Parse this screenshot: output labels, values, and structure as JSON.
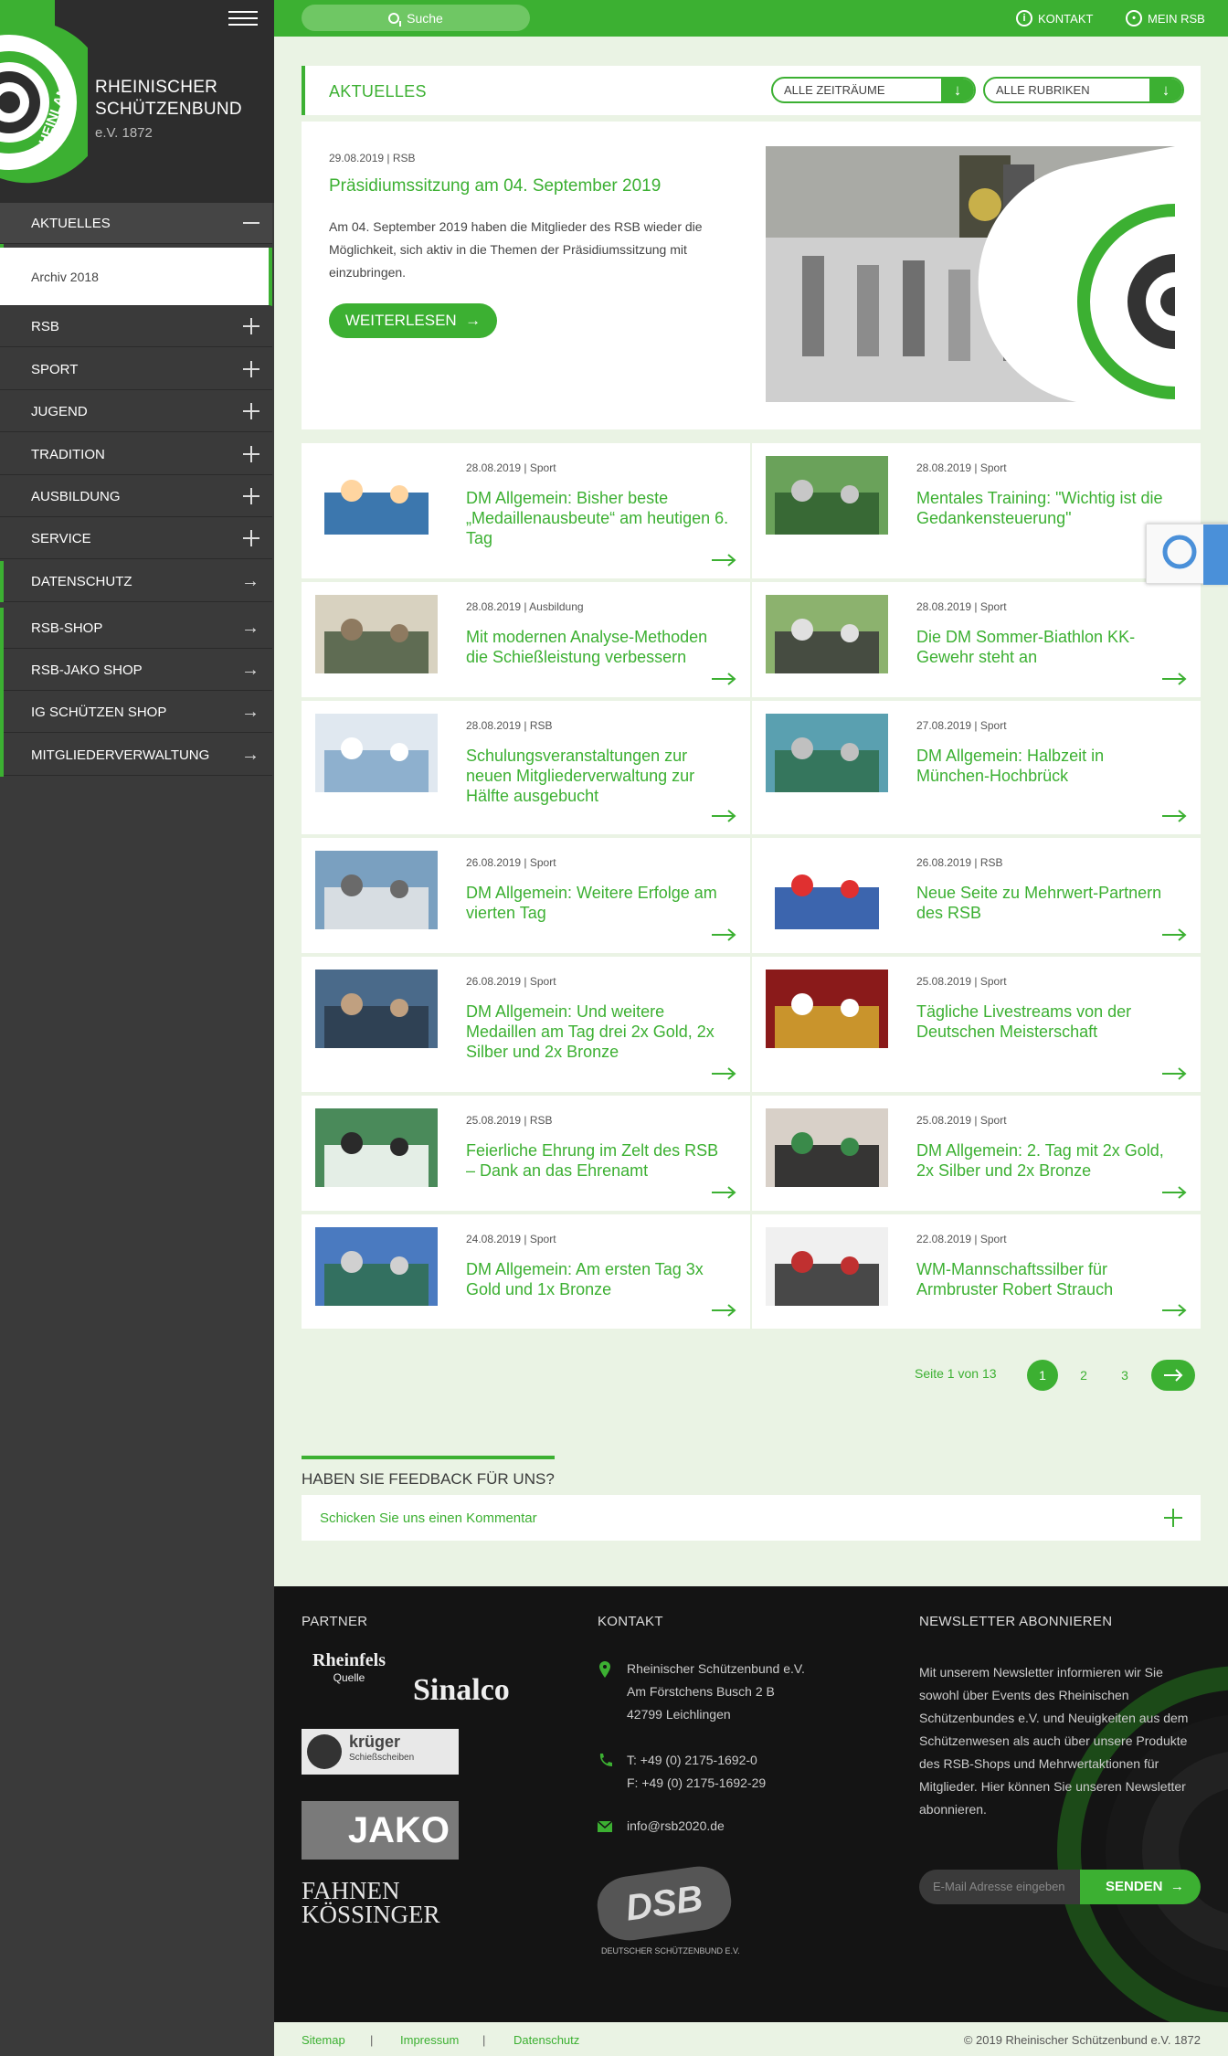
{
  "brand": {
    "name_line1": "RHEINISCHER",
    "name_line2": "SCHÜTZENBUND",
    "sub": "e.V. 1872",
    "logo_text": "RHEINLAND"
  },
  "nav": {
    "aktuelles": "AKTUELLES",
    "archiv": "Archiv 2018",
    "rsb": "RSB",
    "sport": "SPORT",
    "jugend": "JUGEND",
    "tradition": "TRADITION",
    "ausbildung": "AUSBILDUNG",
    "service": "SERVICE",
    "datenschutz": "DATENSCHUTZ",
    "rsbshop": "RSB-SHOP",
    "jako": "RSB-JAKO SHOP",
    "ig": "IG SCHÜTZEN SHOP",
    "mitglieder": "MITGLIEDERVERWALTUNG"
  },
  "topbar": {
    "search": "Suche",
    "kontakt": "KONTAKT",
    "meinrsb": "MEIN RSB"
  },
  "header": {
    "title": "AKTUELLES",
    "filter1": "ALLE ZEITRÄUME",
    "filter2": "ALLE RUBRIKEN"
  },
  "featured": {
    "meta": "29.08.2019 | RSB",
    "title": "Präsidiumssitzung am 04. September 2019",
    "text": "Am 04. September 2019 haben die Mitglieder des RSB wieder die Möglichkeit, sich aktiv in die Themen der Präsidiumssitzung mit einzubringen.",
    "button": "WEITERLESEN"
  },
  "news": [
    {
      "meta": "28.08.2019 | Sport",
      "title": "DM Allgemein: Bisher beste „Medaillenausbeute“ am heutigen 6. Tag"
    },
    {
      "meta": "28.08.2019 | Sport",
      "title": "Mentales Training: \"Wichtig ist die Gedankensteuerung\""
    },
    {
      "meta": "28.08.2019 | Ausbildung",
      "title": "Mit modernen Analyse-Methoden die Schießleistung verbessern"
    },
    {
      "meta": "28.08.2019 | Sport",
      "title": "Die DM Sommer-Biathlon KK-Gewehr steht an"
    },
    {
      "meta": "28.08.2019 | RSB",
      "title": "Schulungsveranstaltungen zur neuen Mitgliederverwaltung zur Hälfte ausgebucht"
    },
    {
      "meta": "27.08.2019 | Sport",
      "title": "DM Allgemein: Halbzeit in München-Hochbrück"
    },
    {
      "meta": "26.08.2019 | Sport",
      "title": "DM Allgemein: Weitere Erfolge am vierten Tag"
    },
    {
      "meta": "26.08.2019 | RSB",
      "title": "Neue Seite zu Mehrwert-Partnern des RSB"
    },
    {
      "meta": "26.08.2019 | Sport",
      "title": "DM Allgemein: Und weitere Medaillen am Tag drei 2x Gold, 2x Silber und 2x Bronze"
    },
    {
      "meta": "25.08.2019 | Sport",
      "title": "Tägliche Livestreams von der Deutschen Meisterschaft"
    },
    {
      "meta": "25.08.2019 | RSB",
      "title": "Feierliche Ehrung im Zelt des RSB – Dank an das Ehrenamt"
    },
    {
      "meta": "25.08.2019 | Sport",
      "title": "DM Allgemein: 2. Tag mit 2x Gold, 2x Silber und 2x Bronze"
    },
    {
      "meta": "24.08.2019 | Sport",
      "title": "DM Allgemein: Am ersten Tag 3x Gold und 1x Bronze"
    },
    {
      "meta": "22.08.2019 | Sport",
      "title": "WM-Mannschaftssilber für Armbruster Robert Strauch"
    }
  ],
  "pager": {
    "text": "Seite 1 von 13",
    "p1": "1",
    "p2": "2",
    "p3": "3"
  },
  "feedback": {
    "title": "HABEN SIE FEEDBACK FÜR UNS?",
    "toggle": "Schicken Sie uns einen Kommentar"
  },
  "footer": {
    "partner": "PARTNER",
    "kontakt": "KONTAKT",
    "newsletter": "NEWSLETTER ABONNIEREN",
    "addr1": "Rheinischer Schützenbund e.V.",
    "addr2": "Am Förstchens Busch 2 B",
    "addr3": "42799 Leichlingen",
    "tel": "T: +49 (0) 2175-1692-0",
    "fax": "F: +49 (0) 2175-1692-29",
    "mail": "info@rsb2020.de",
    "nl_text": "Mit unserem Newsletter informieren wir Sie sowohl über Events des Rheinischen Schützenbundes e.V. und Neuigkeiten aus dem Schützenwesen als auch über unsere Produkte des RSB-Shops und Mehrwertaktionen für Mitglieder. Hier können Sie unseren Newsletter abonnieren.",
    "email_placeholder": "E-Mail Adresse eingeben",
    "send": "SENDEN",
    "partners": {
      "rheinfels": "Rheinfels",
      "rheinfels_sub": "Quelle",
      "sinalco": "Sinalco",
      "krueger": "krüger",
      "krueger_sub": "Schießscheiben",
      "jako": "JAKO",
      "fahnen1": "FAHNEN",
      "fahnen2": "KÖSSINGER",
      "dsb": "DSB",
      "dsb_sub": "DEUTSCHER SCHÜTZENBUND E.V."
    }
  },
  "bottom": {
    "sitemap": "Sitemap",
    "impressum": "Impressum",
    "datenschutz": "Datenschutz",
    "copyright": "© 2019 Rheinischer Schützenbund e.V. 1872"
  },
  "colors": {
    "accent": "#3cb032",
    "sidebar": "#3a3a3a",
    "footer": "#141414",
    "background": "#eaf3e4"
  }
}
